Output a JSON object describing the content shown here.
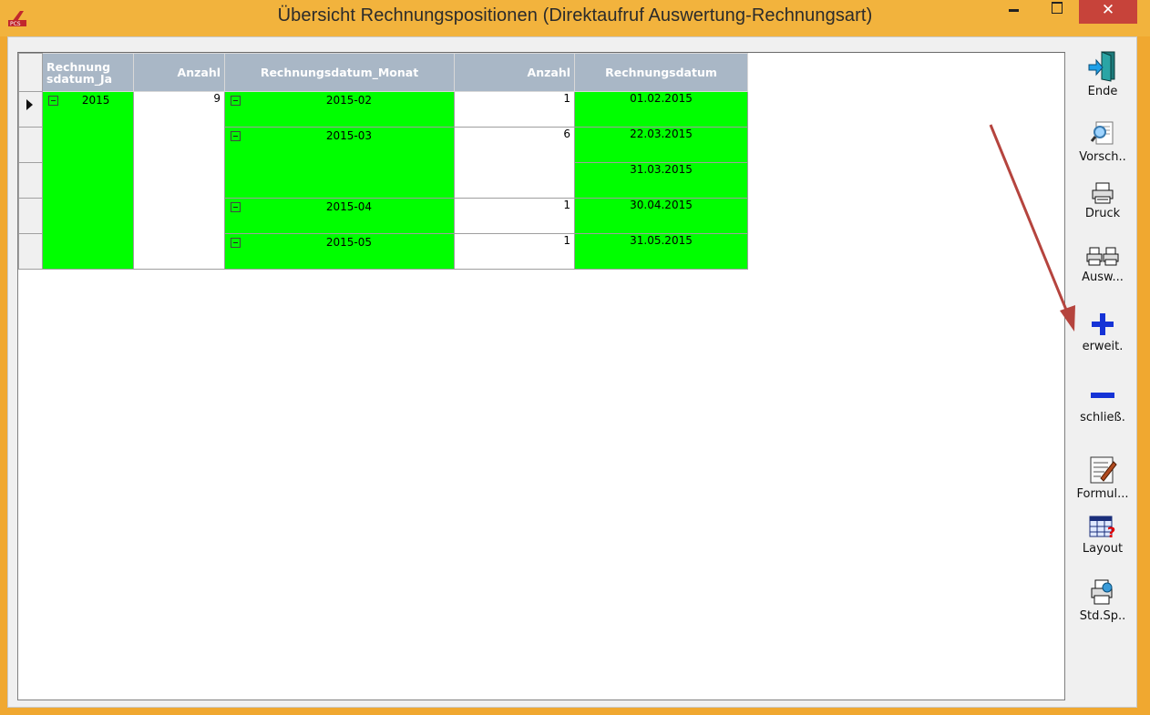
{
  "window": {
    "title": "Übersicht Rechnungspositionen (Direktaufruf Auswertung-Rechnungsart)",
    "app_icon": "pcs-logo-icon",
    "close_glyph": "✕",
    "accent_color": "#f2b33d",
    "close_color": "#c7433a"
  },
  "grid": {
    "headers": [
      "Rechnung sdatum_Ja",
      "Anzahl",
      "Rechnungsdatum_Monat",
      "Anzahl",
      "Rechnungsdatum"
    ],
    "header_color": "#a9b7c6",
    "highlight_color": "#00ff00",
    "year": {
      "value": "2015",
      "count": "9"
    },
    "months": [
      {
        "month": "2015-02",
        "count": "1",
        "dates": [
          "01.02.2015"
        ]
      },
      {
        "month": "2015-03",
        "count": "6",
        "dates": [
          "22.03.2015",
          "31.03.2015"
        ]
      },
      {
        "month": "2015-04",
        "count": "1",
        "dates": [
          "30.04.2015"
        ]
      },
      {
        "month": "2015-05",
        "count": "1",
        "dates": [
          "31.05.2015"
        ]
      }
    ]
  },
  "toolbar": {
    "ende": "Ende",
    "vorsch": "Vorsch..",
    "druck": "Druck",
    "ausw": "Ausw...",
    "erweit": "erweit.",
    "schliess": "schließ.",
    "formul": "Formul...",
    "layout": "Layout",
    "stdsp": "Std.Sp.."
  },
  "annotation": {
    "arrow_color": "#b5443e"
  }
}
